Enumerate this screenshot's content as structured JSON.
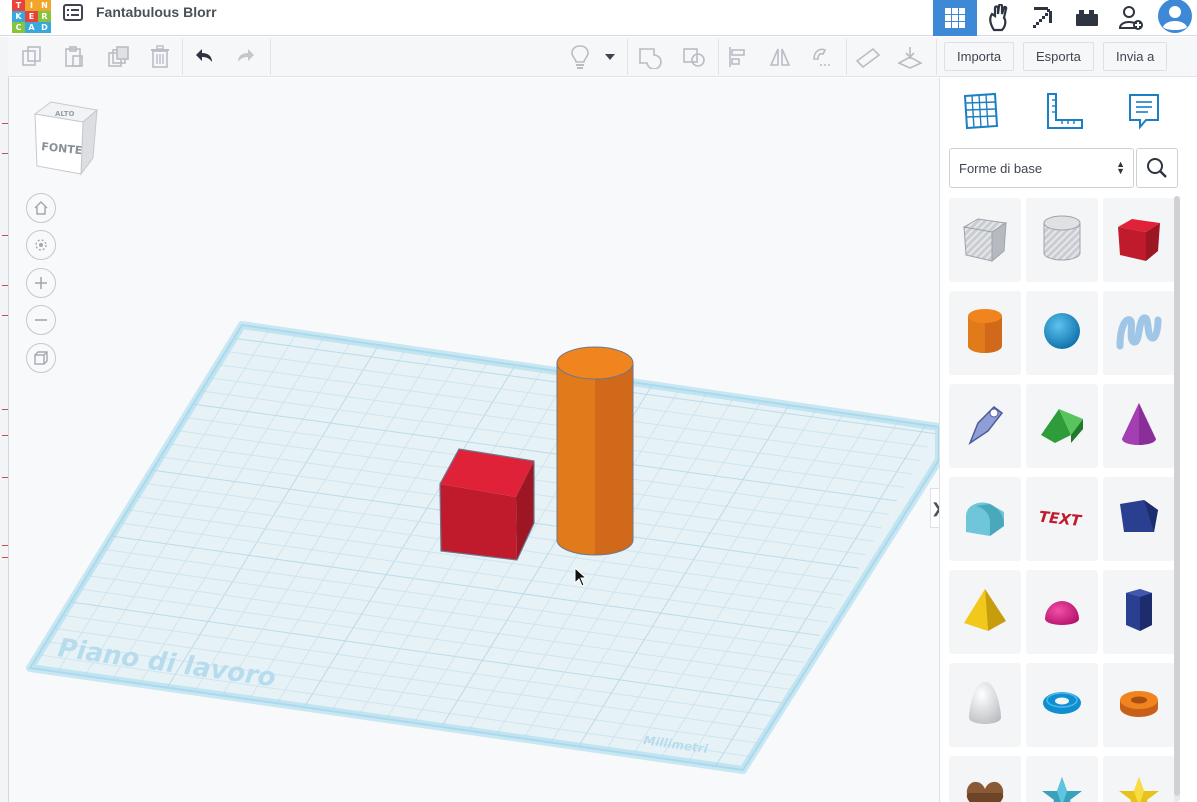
{
  "app": {
    "title": "Fantabulous Blorr",
    "logo_letters": [
      "T",
      "I",
      "N",
      "K",
      "E",
      "R",
      "C",
      "A",
      "D"
    ],
    "logo_colors": [
      "#e8433b",
      "#f2a52b",
      "#f2a52b",
      "#3aa8dc",
      "#e8433b",
      "#86c440",
      "#86c440",
      "#3aa8dc",
      "#3aa8dc"
    ]
  },
  "header_icons": [
    "grid-3d-icon",
    "circuits-hand-icon",
    "pickaxe-icon",
    "blocks-icon",
    "add-user-icon",
    "profile-avatar-icon"
  ],
  "toolbar": {
    "import_label": "Importa",
    "export_label": "Esporta",
    "send_label": "Invia a"
  },
  "viewcube": {
    "top_label": "ALTO",
    "front_label": "FONTE"
  },
  "workplane": {
    "label": "Piano di lavoro",
    "units_label": "Millimetri",
    "color": "#bfe3f2"
  },
  "panel": {
    "shapes_category": "Forme di base",
    "shapes": [
      "box-hole-icon",
      "cylinder-hole-icon",
      "box-icon",
      "cylinder-icon",
      "sphere-icon",
      "scribble-icon",
      "shape-generator-icon",
      "roof-icon",
      "cone-icon",
      "round-roof-icon",
      "text-icon",
      "wedge-icon",
      "pyramid-icon",
      "half-sphere-icon",
      "polygon-icon",
      "paraboloid-icon",
      "torus-icon",
      "tube-icon",
      "heart-icon",
      "star-icon",
      "star-gold-icon"
    ]
  },
  "colors": {
    "accent": "#3d89d6",
    "red_box": "#c91f2e",
    "orange_cylinder": "#e07a1b"
  }
}
